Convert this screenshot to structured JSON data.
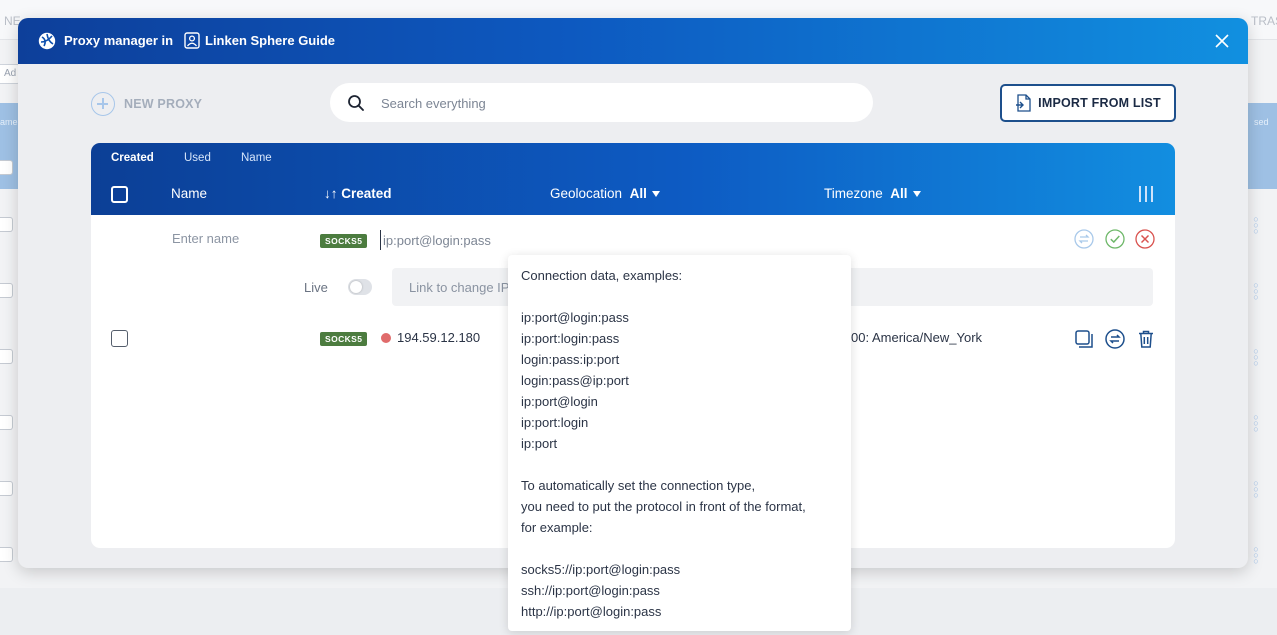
{
  "background": {
    "topbar_left": "NE",
    "topbar_right": "TRAS",
    "add_label": "Ad",
    "left_header_text": "ame",
    "right_header_text": "sed"
  },
  "modal": {
    "title": "Proxy manager in",
    "workspace": "Linken Sphere Guide",
    "new_proxy_label": "NEW PROXY",
    "search_placeholder": "Search everything",
    "import_label": "IMPORT FROM LIST"
  },
  "table": {
    "sort_tabs": [
      "Created",
      "Used",
      "Name"
    ],
    "active_sort_tab": "Created",
    "columns": {
      "name": "Name",
      "created_arrows": "↓↑",
      "created": "Created",
      "geolocation": "Geolocation",
      "geolocation_filter": "All",
      "timezone": "Timezone",
      "timezone_filter": "All"
    }
  },
  "edit_row": {
    "name_placeholder": "Enter name",
    "type_badge": "SOCKS5",
    "connection_placeholder": "ip:port@login:pass",
    "live_label": "Live",
    "live_on": false,
    "link_placeholder": "Link to change IP"
  },
  "proxies": [
    {
      "type_badge": "SOCKS5",
      "status_color": "#e06b6b",
      "ip": "194.59.12.180",
      "timezone": "00: America/New_York"
    }
  ],
  "tooltip": {
    "lines": [
      "Connection data, examples:",
      "",
      "ip:port@login:pass",
      "ip:port:login:pass",
      "login:pass:ip:port",
      "login:pass@ip:port",
      "ip:port@login",
      "ip:port:login",
      "ip:port",
      "",
      "To automatically set the connection type,",
      "you need to put the protocol in front of the format,",
      "for example:",
      "",
      "socks5://ip:port@login:pass",
      "ssh://ip:port@login:pass",
      "http://ip:port@login:pass"
    ]
  },
  "colors": {
    "header_gradient_start": "#0c3f96",
    "header_gradient_end": "#128ee0",
    "badge_green": "#4c7c3f",
    "offline_red": "#e06b6b"
  },
  "icons": [
    "sphere-logo-icon",
    "workspace-icon",
    "close-icon",
    "plus-icon",
    "search-icon",
    "import-file-icon",
    "columns-icon",
    "swap-icon",
    "check-icon",
    "cancel-icon",
    "copy-icon",
    "delete-icon"
  ]
}
